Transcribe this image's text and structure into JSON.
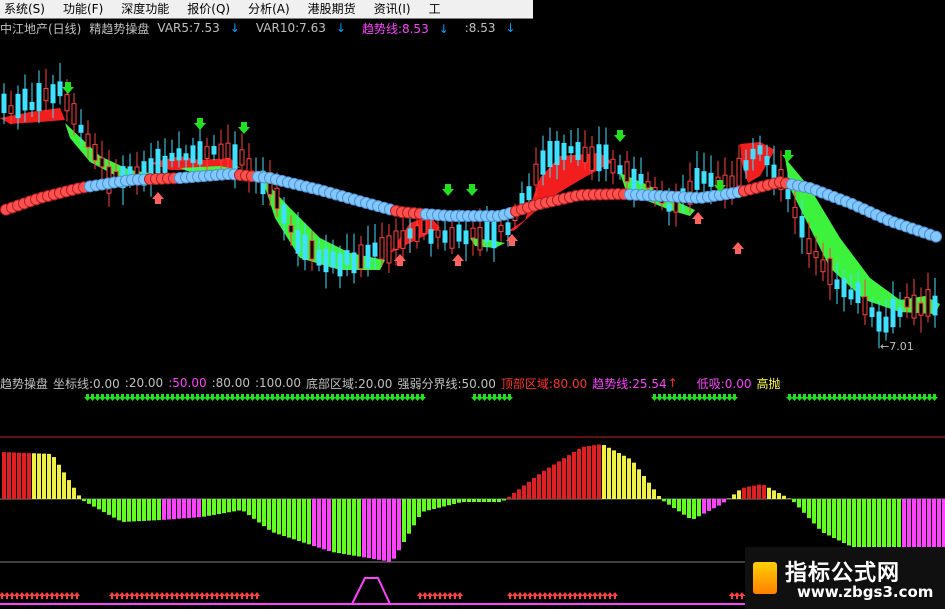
{
  "menu": {
    "items": [
      "系统(S)",
      "功能(F)",
      "深度功能",
      "报价(Q)",
      "分析(A)",
      "港股期货",
      "资讯(I)",
      "工"
    ]
  },
  "title_bar": {
    "stock": "中江地产(日线)",
    "indicator_name": "精趋势操盘",
    "var5": "VAR5:7.53",
    "var10": "VAR10:7.63",
    "trend_line": "趋势线:8.53",
    "trend_line2": ":8.53"
  },
  "main_chart": {
    "low_marker": "←7.01"
  },
  "indicator": {
    "title": "趋势操盘",
    "axis_label": "坐标线:0.00",
    "v20": ":20.00",
    "v50": ":50.00",
    "v80": ":80.00",
    "v100": ":100.00",
    "bottom_zone": "底部区域:20.00",
    "divider": "强弱分界线:50.00",
    "top_zone": "顶部区域:80.00",
    "trend": "趋势线:25.54",
    "trend_arrow": "↑",
    "low_buy": "低吸:0.00",
    "high_sell": "高抛"
  },
  "watermark": {
    "brand": "指标公式网",
    "url": "www.zbgs3.com"
  },
  "colors": {
    "background": "#000000",
    "up_candle": "#ff4040",
    "down_candle": "#40e0ff",
    "ribbon_green": "#40ff40",
    "ribbon_red": "#ff2020",
    "bead_red": "#ff5050",
    "bead_blue": "#80c8ff",
    "bar_yellow": "#f0f040",
    "bar_red": "#e02020",
    "bar_green": "#60ff20",
    "bar_magenta": "#ff40ff"
  }
}
